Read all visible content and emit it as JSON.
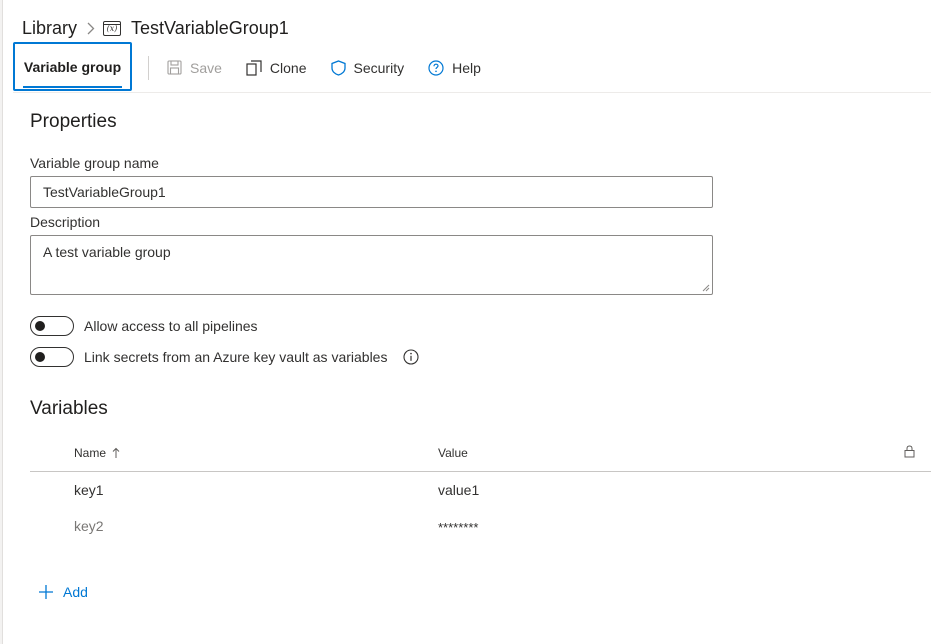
{
  "breadcrumb": {
    "library": "Library",
    "group_name": "TestVariableGroup1",
    "group_icon_text": "(x)"
  },
  "toolbar": {
    "active_tab": "Variable group",
    "save_label": "Save",
    "clone_label": "Clone",
    "security_label": "Security",
    "help_label": "Help"
  },
  "properties": {
    "title": "Properties",
    "name_label": "Variable group name",
    "name_value": "TestVariableGroup1",
    "description_label": "Description",
    "description_value": "A test variable group",
    "allow_access_label": "Allow access to all pipelines",
    "allow_access_on": false,
    "link_secrets_label": "Link secrets from an Azure key vault as variables",
    "link_secrets_on": false
  },
  "variables": {
    "title": "Variables",
    "columns": {
      "name": "Name",
      "value": "Value"
    },
    "rows": [
      {
        "name": "key1",
        "value": "value1",
        "secret": false
      },
      {
        "name": "key2",
        "value": "********",
        "secret": true
      }
    ],
    "add_label": "Add"
  },
  "colors": {
    "accent": "#0078d4",
    "text": "#323130",
    "muted": "#605e5c"
  }
}
